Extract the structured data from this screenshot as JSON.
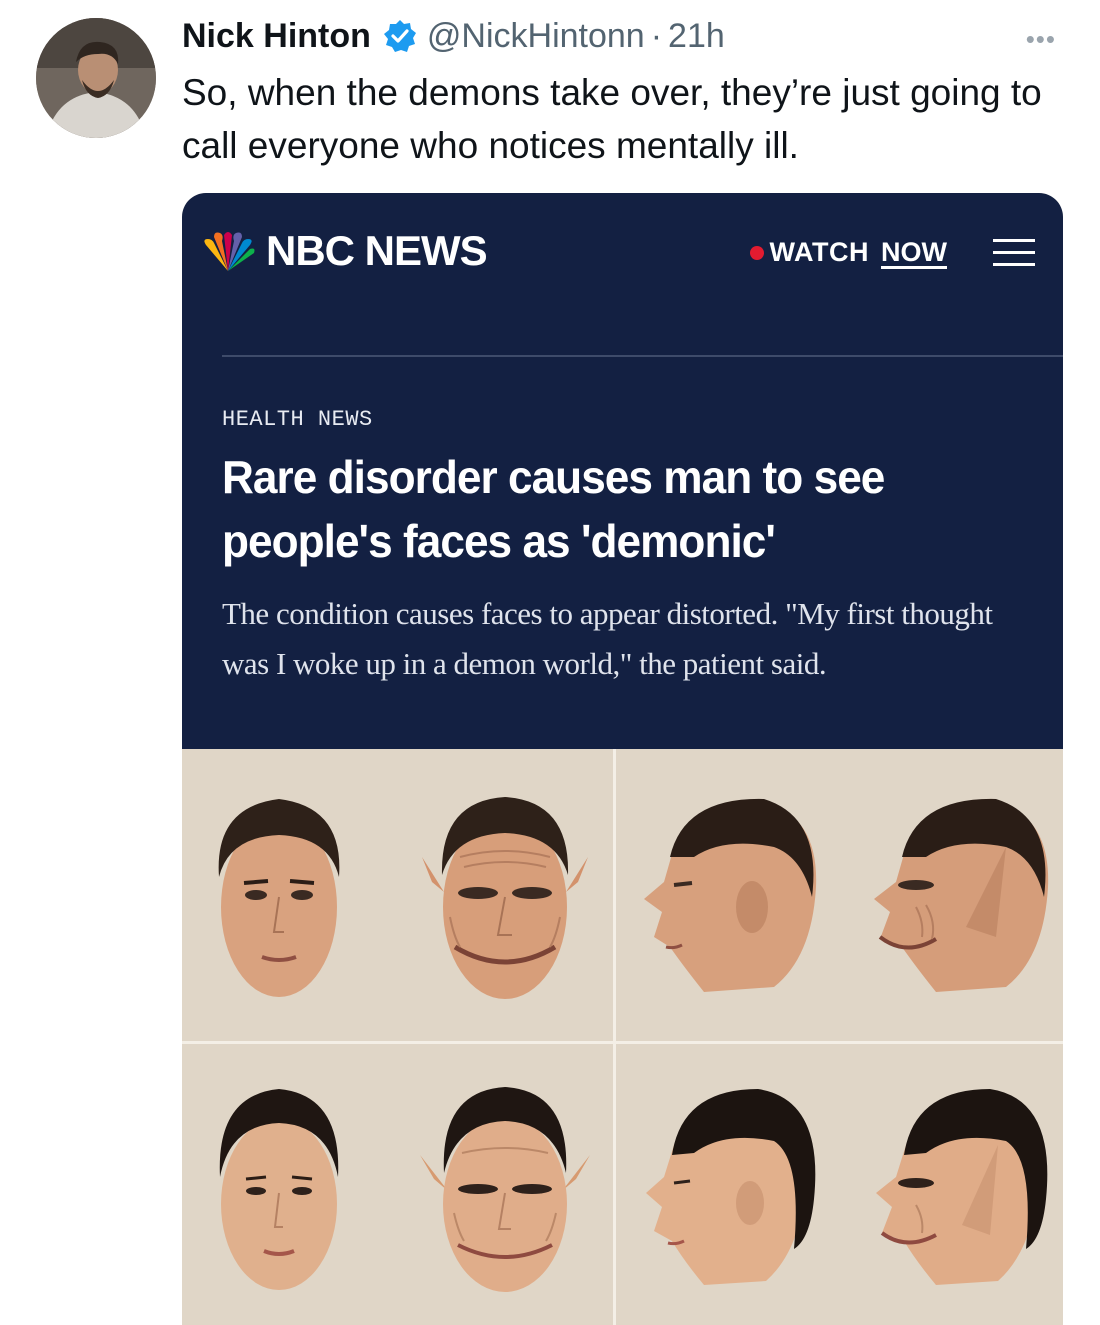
{
  "tweet": {
    "author_name": "Nick Hinton",
    "handle": "@NickHintonn",
    "separator": "·",
    "time": "21h",
    "more_label": "•••",
    "text": "So, when the demons take over, they’re just going to call everyone who notices mentally ill."
  },
  "card": {
    "brand": "NBC NEWS",
    "watch_label": "WATCH",
    "now_label": "NOW",
    "section": "HEALTH NEWS",
    "headline": "Rare disorder causes man to see people's faces as 'demonic'",
    "dek": "The condition causes faces to appear distorted. \"My first thought was I woke up in a demon world,\" the patient said.",
    "colors": {
      "nbc_navy": "#132042",
      "live_red": "#e21b30",
      "image_background": "#e0d6c7",
      "verified_blue": "#1d9bf0"
    }
  }
}
